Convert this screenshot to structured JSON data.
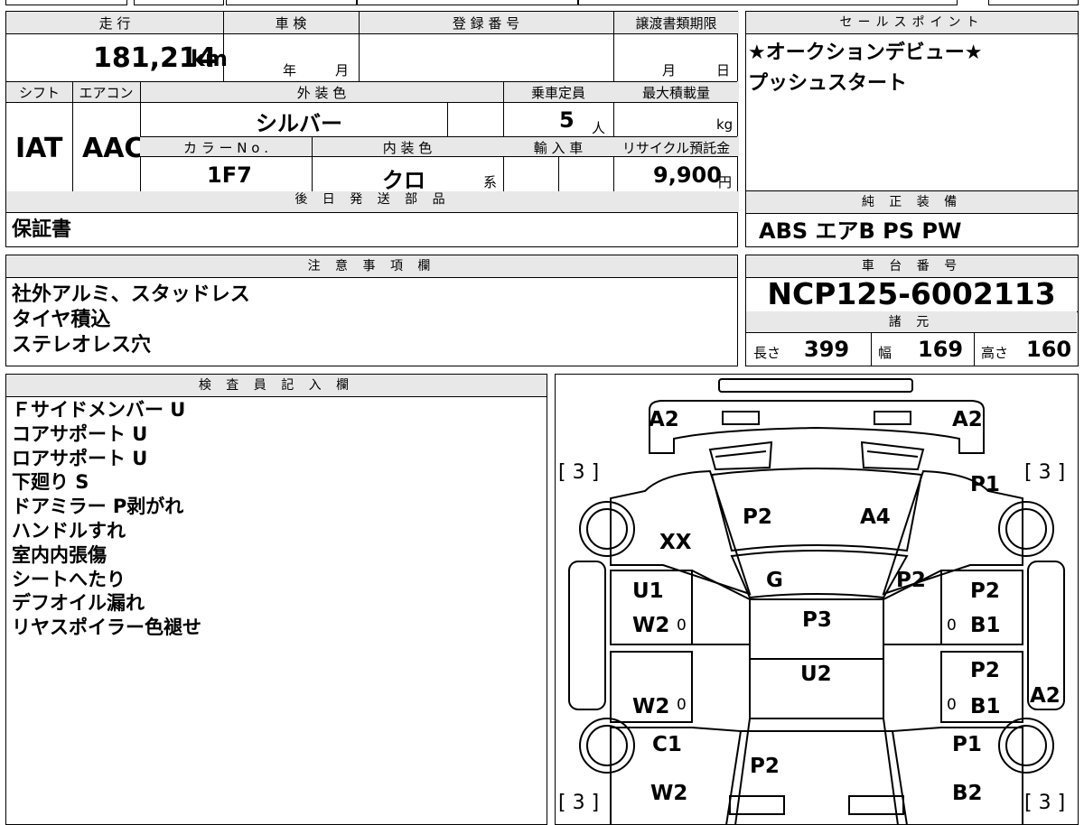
{
  "vehicle": {
    "mileage_header": "走 行",
    "mileage": "181,214",
    "mileage_unit": "km",
    "inspection_header": "車 検",
    "inspection_year": "年",
    "inspection_month": "月",
    "registration_header": "登 録 番 号",
    "transfer_header": "譲渡書類期限",
    "transfer_month": "月",
    "transfer_day": "日",
    "shift_header": "シフト",
    "shift": "IAT",
    "ac_header": "エアコン",
    "ac": "AAC",
    "exterior_color_header": "外 装 色",
    "exterior_color": "シルバー",
    "capacity_header": "乗車定員",
    "capacity": "5",
    "capacity_unit": "人",
    "max_load_header": "最大積載量",
    "max_load_unit": "kg",
    "color_no_header": "カ ラ ー N o .",
    "color_no": "1F7",
    "interior_color_header": "内 装 色",
    "interior_color": "クロ",
    "interior_color_suffix": "系",
    "import_header": "輸 入 車",
    "recycle_header": "リサイクル預託金",
    "recycle_fee": "9,900",
    "recycle_unit": "円",
    "later_parts_header": "後 日 発 送 部 品",
    "later_parts": "保証書"
  },
  "sales_points": {
    "header": "セールスポイント",
    "lines": [
      "★オークションデビュー★",
      "プッシュスタート"
    ]
  },
  "equipment": {
    "header": "純 正 装 備",
    "value": "ABS エアB PS PW"
  },
  "notes": {
    "header": "注 意 事 項 欄",
    "lines": [
      "社外アルミ、スタッドレス",
      "タイヤ積込",
      "ステレオレス穴"
    ]
  },
  "chassis": {
    "header": "車 台 番 号",
    "number": "NCP125-6002113",
    "specs_header": "諸 元",
    "length_label": "長さ",
    "length": "399",
    "width_label": "幅",
    "width": "169",
    "height_label": "高さ",
    "height": "160"
  },
  "inspector": {
    "header": "検 査 員 記 入 欄",
    "lines": [
      "Ｆサイドメンバー U",
      "コアサポート U",
      "ロアサポート U",
      "下廻り S",
      "ドアミラー P剥がれ",
      "ハンドルすれ",
      "室内内張傷",
      "シートへたり",
      "デフオイル漏れ",
      "リヤスポイラー色褪せ"
    ]
  },
  "diagram": {
    "labels": {
      "front_left": "A2",
      "front_right": "A2",
      "tire_fl": "[ 3 ]",
      "tire_fr": "[ 3 ]",
      "tire_rl": "[ 3 ]",
      "tire_rr": "[ 3 ]",
      "fender_fr": "P1",
      "hood_l": "P2",
      "hood_r": "A4",
      "fender_fl": "XX",
      "windshield": "G",
      "pillar_r": "P2",
      "door_fl_1": "U1",
      "door_fl_2": "W2",
      "door_fr_1": "P2",
      "door_fr_2": "B1",
      "roof": "P3",
      "roof_rear": "U2",
      "door_rl_1": "W2",
      "door_rr_1": "P2",
      "door_rr_2": "B1",
      "side_r": "A2",
      "qtr_l": "C1",
      "qtr_r": "P1",
      "trunk": "P2",
      "rear_l": "W2",
      "rear_r": "B2",
      "zero": "0"
    }
  }
}
